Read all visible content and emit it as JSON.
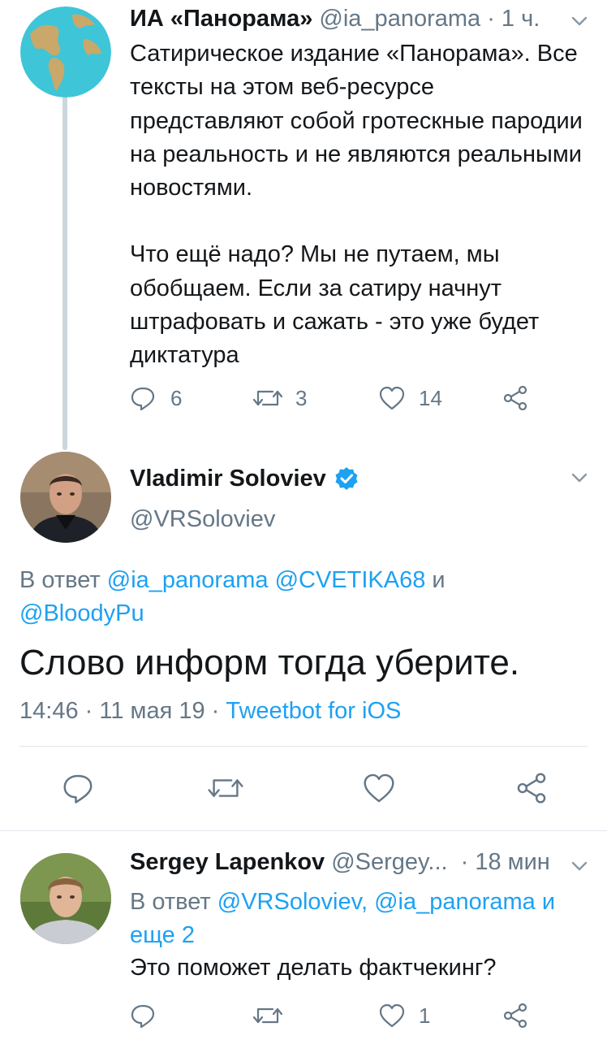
{
  "tweet1": {
    "name": "ИА «Панорама»",
    "handle": "@ia_panorama",
    "time": "· 1 ч.",
    "paragraph1": "Сатирическое издание «Панорама». Все тексты на этом веб-ресурсе представляют собой гротескные пародии на реальность и не являются реальными новостями.",
    "paragraph2": "Что ещё надо? Мы не путаем, мы обобщаем. Если за сатиру начнут штрафовать и сажать - это уже будет диктатура",
    "replies": "6",
    "retweets": "3",
    "likes": "14"
  },
  "tweet2": {
    "name": "Vladimir Soloviev",
    "handle": "@VRSoloviev",
    "reply_prefix": "В ответ",
    "reply_mention1": "@ia_panorama",
    "reply_mention2": "@CVETIKA68",
    "reply_and": "и",
    "reply_mention3": "@BloodyPu",
    "text": "Слово информ тогда уберите.",
    "timestamp": "14:46 · 11 мая 19 ·",
    "client": "Tweetbot for iOS"
  },
  "tweet3": {
    "name": "Sergey Lapenkov",
    "handle": "@Sergey...",
    "time": "· 18 мин",
    "reply_prefix": "В ответ",
    "reply_mentions": "@VRSoloviev, @ia_panorama и еще 2",
    "text": "Это поможет делать фактчекинг?",
    "likes": "1"
  },
  "colors": {
    "accent": "#1da1f2",
    "secondary_text": "#657786",
    "primary_text": "#14171a",
    "divider": "#e1e8ed"
  },
  "icons": [
    "globe-avatar",
    "chevron-down-icon",
    "reply-icon",
    "retweet-icon",
    "like-icon",
    "share-icon",
    "verified-badge-icon"
  ]
}
